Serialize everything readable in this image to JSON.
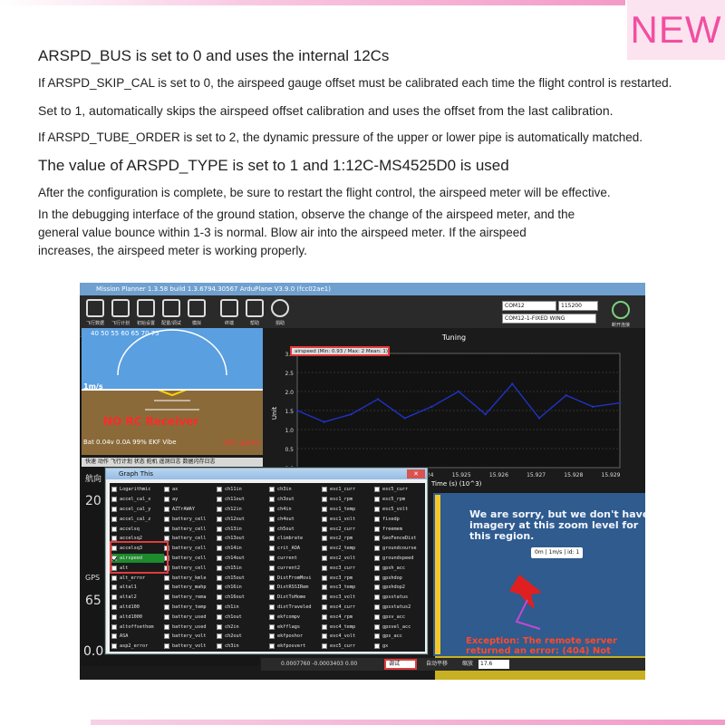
{
  "badge": "NEW",
  "lines": [
    "ARSPD_BUS is set to 0 and uses the internal 12Cs",
    "If ARSPD_SKIP_CAL is set to 0, the airspeed gauge offset must be calibrated each time the flight control is restarted.",
    " Set to 1, automatically skips the airspeed offset calibration and uses the offset from the last calibration.",
    "If ARSPD_TUBE_ORDER is set to 2, the dynamic pressure of the upper or lower pipe is automatically matched.",
    "The value of ARSPD_TYPE is set to 1 and 1:12C-MS4525D0 is used",
    "After the configuration is complete, be sure to restart the flight control, the airspeed meter will be effective.",
    "In the debugging interface of the ground station, observe the change of the airspeed meter, and the",
    "general value bounce within 1-3 is normal. Blow air into the airspeed meter. If the airspeed",
    "increases, the airspeed meter is working properly."
  ],
  "app": {
    "title": "Mission Planner 1.3.58 build 1.3.6794.30567 ArduPlane V3.9.0 (fcc02ae1)",
    "toolbar": [
      "飞行数据",
      "飞行计划",
      "初始设置",
      "配置/调试",
      "模拟",
      "终端",
      "帮助",
      "捐助"
    ],
    "port": "COM12",
    "baud": "115200",
    "vehicle": "COM12-1-FIXED WING",
    "connect": "断开连接"
  },
  "hud": {
    "top": "40  50  55  60  65  70  75",
    "alt_label": "1m/s",
    "norc": "NO RC Receiver",
    "bottom": "Bat 0.04v 0.0A  99%  EKF  Vibe",
    "gps": "GPS: 无GPS"
  },
  "tabs": "快速  动作  飞行计划  状态  舵机  遥测日志  数据闪存日志",
  "left_values": {
    "v1": "0.00",
    "v2": "1186.00",
    "v3": "1520.00",
    "v4": "1520.00",
    "big1": "20",
    "big2": "65",
    "lab1": "航向",
    "lab2": "GPS"
  },
  "chart_data": {
    "type": "line",
    "title": "Tuning",
    "series": [
      {
        "name": "airspeed (Min: 0.93 / Max: 2 Mean: 1)",
        "color": "#1f33c8",
        "x": [
          15.917,
          15.918,
          15.919,
          15.92,
          15.921,
          15.922,
          15.923,
          15.924,
          15.925,
          15.926,
          15.927,
          15.928,
          15.929
        ],
        "values": [
          1.5,
          1.2,
          1.4,
          1.8,
          1.3,
          1.6,
          2.0,
          1.4,
          2.2,
          1.3,
          1.9,
          1.6,
          1.7
        ]
      }
    ],
    "xlabel": "Time (s) (10^3)",
    "ylabel": "Unit",
    "ylim": [
      0,
      3.0
    ],
    "yticks": [
      "0.0",
      "0.5",
      "1.0",
      "1.5",
      "2.0",
      "2.5",
      "3.0"
    ],
    "xticks": [
      "15.924",
      "15.925",
      "15.926",
      "15.927",
      "15.928",
      "15.929"
    ]
  },
  "dialog": {
    "title": "Graph This",
    "columns": [
      [
        {
          "label": "Logarithmic",
          "checked": false
        },
        {
          "label": "accel_cal_x",
          "checked": false
        },
        {
          "label": "accel_cal_y",
          "checked": false
        },
        {
          "label": "accel_cal_z",
          "checked": false
        },
        {
          "label": "accelsq",
          "checked": false
        },
        {
          "label": "accelsq2",
          "checked": false
        },
        {
          "label": "accelsq3",
          "checked": false
        },
        {
          "label": "airspeed",
          "checked": true
        },
        {
          "label": "alt",
          "checked": false
        },
        {
          "label": "alt_error",
          "checked": false
        },
        {
          "label": "altal1",
          "checked": false
        },
        {
          "label": "altal2",
          "checked": false
        },
        {
          "label": "altd100",
          "checked": false
        },
        {
          "label": "altd1000",
          "checked": false
        },
        {
          "label": "altoffsethom",
          "checked": false
        },
        {
          "label": "ASA",
          "checked": false
        },
        {
          "label": "asp2_error",
          "checked": false
        }
      ],
      [
        {
          "label": "ax",
          "checked": false
        },
        {
          "label": "ay",
          "checked": false
        },
        {
          "label": "AZTrAWAY",
          "checked": false
        },
        {
          "label": "battery_cell",
          "checked": false
        },
        {
          "label": "battery_cell",
          "checked": false
        },
        {
          "label": "battery_cell",
          "checked": false
        },
        {
          "label": "battery_cell",
          "checked": false
        },
        {
          "label": "battery_cell",
          "checked": false
        },
        {
          "label": "battery_cell",
          "checked": false
        },
        {
          "label": "battery_kmle",
          "checked": false
        },
        {
          "label": "battery_mahp",
          "checked": false
        },
        {
          "label": "battery_rema",
          "checked": false
        },
        {
          "label": "battery_temp",
          "checked": false
        },
        {
          "label": "battery_used",
          "checked": false
        },
        {
          "label": "battery_used",
          "checked": false
        },
        {
          "label": "battery_volt",
          "checked": false
        },
        {
          "label": "battery_volt",
          "checked": false
        }
      ],
      [
        {
          "label": "ch11in",
          "checked": false
        },
        {
          "label": "ch11out",
          "checked": false
        },
        {
          "label": "ch12in",
          "checked": false
        },
        {
          "label": "ch12out",
          "checked": false
        },
        {
          "label": "ch13in",
          "checked": false
        },
        {
          "label": "ch13out",
          "checked": false
        },
        {
          "label": "ch14in",
          "checked": false
        },
        {
          "label": "ch14out",
          "checked": false
        },
        {
          "label": "ch15in",
          "checked": false
        },
        {
          "label": "ch15out",
          "checked": false
        },
        {
          "label": "ch16in",
          "checked": false
        },
        {
          "label": "ch16out",
          "checked": false
        },
        {
          "label": "ch1in",
          "checked": false
        },
        {
          "label": "ch1out",
          "checked": false
        },
        {
          "label": "ch2in",
          "checked": false
        },
        {
          "label": "ch2out",
          "checked": false
        },
        {
          "label": "ch3in",
          "checked": false
        }
      ],
      [
        {
          "label": "ch3in",
          "checked": false
        },
        {
          "label": "ch3out",
          "checked": false
        },
        {
          "label": "ch4in",
          "checked": false
        },
        {
          "label": "ch4out",
          "checked": false
        },
        {
          "label": "ch5out",
          "checked": false
        },
        {
          "label": "climbrate",
          "checked": false
        },
        {
          "label": "crit_AOA",
          "checked": false
        },
        {
          "label": "current",
          "checked": false
        },
        {
          "label": "current2",
          "checked": false
        },
        {
          "label": "DistFromMovi",
          "checked": false
        },
        {
          "label": "DistRSSIRem",
          "checked": false
        },
        {
          "label": "DistToHome",
          "checked": false
        },
        {
          "label": "distTraveled",
          "checked": false
        },
        {
          "label": "ekfcompv",
          "checked": false
        },
        {
          "label": "ekfflags",
          "checked": false
        },
        {
          "label": "ekfposhor",
          "checked": false
        },
        {
          "label": "ekfposvert",
          "checked": false
        }
      ],
      [
        {
          "label": "esc1_curr",
          "checked": false
        },
        {
          "label": "esc1_rpm",
          "checked": false
        },
        {
          "label": "esc1_temp",
          "checked": false
        },
        {
          "label": "esc1_volt",
          "checked": false
        },
        {
          "label": "esc2_curr",
          "checked": false
        },
        {
          "label": "esc2_rpm",
          "checked": false
        },
        {
          "label": "esc2_temp",
          "checked": false
        },
        {
          "label": "esc2_volt",
          "checked": false
        },
        {
          "label": "esc3_curr",
          "checked": false
        },
        {
          "label": "esc3_rpm",
          "checked": false
        },
        {
          "label": "esc3_temp",
          "checked": false
        },
        {
          "label": "esc3_volt",
          "checked": false
        },
        {
          "label": "esc4_curr",
          "checked": false
        },
        {
          "label": "esc4_rpm",
          "checked": false
        },
        {
          "label": "esc4_temp",
          "checked": false
        },
        {
          "label": "esc4_volt",
          "checked": false
        },
        {
          "label": "esc5_curr",
          "checked": false
        }
      ],
      [
        {
          "label": "esc5_curr",
          "checked": false
        },
        {
          "label": "esc5_rpm",
          "checked": false
        },
        {
          "label": "esc5_volt",
          "checked": false
        },
        {
          "label": "fixedp",
          "checked": false
        },
        {
          "label": "freemem",
          "checked": false
        },
        {
          "label": "GeoFenceDist",
          "checked": false
        },
        {
          "label": "groundcourse",
          "checked": false
        },
        {
          "label": "groundspeed",
          "checked": false
        },
        {
          "label": "gpsh_acc",
          "checked": false
        },
        {
          "label": "gpshdop",
          "checked": false
        },
        {
          "label": "gpshdop2",
          "checked": false
        },
        {
          "label": "gpsstatus",
          "checked": false
        },
        {
          "label": "gpsstatus2",
          "checked": false
        },
        {
          "label": "gpsv_acc",
          "checked": false
        },
        {
          "label": "gpsvel_acc",
          "checked": false
        },
        {
          "label": "gps_acc",
          "checked": false
        },
        {
          "label": "gx",
          "checked": false
        }
      ]
    ]
  },
  "map": {
    "msg": "We are sorry, but we don't have imagery at this zoom level for this region.",
    "exc": "Exception: The remote server returned an error: (404) Not",
    "speed": "0m | 1m/s | id: 1"
  },
  "status": {
    "coords": "0.0007760 -0.0003403  0.00",
    "check_label": "调试",
    "auto": "自动平移",
    "zoom_label": "缩放",
    "zoom": "17.6"
  }
}
